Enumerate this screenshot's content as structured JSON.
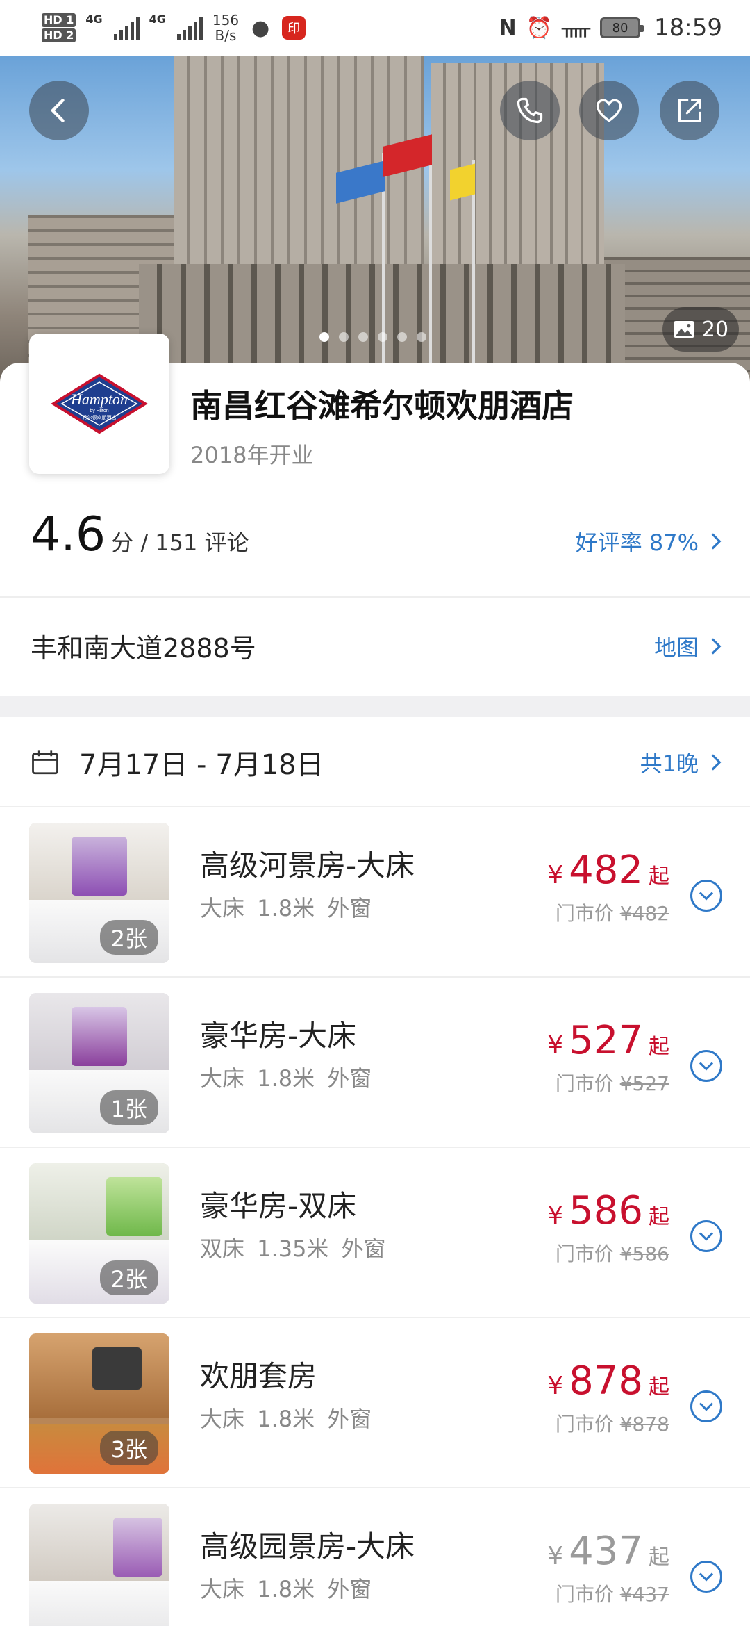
{
  "status_bar": {
    "hd1": "HD 1",
    "hd2": "HD 2",
    "sim1": "4G",
    "sim2": "4G",
    "net_speed_value": "156",
    "net_speed_unit": "B/s",
    "battery": "80",
    "time": "18:59"
  },
  "hero": {
    "photo_count": "20",
    "dots_total": 6,
    "dots_active": 1
  },
  "hotel": {
    "name": "南昌红谷滩希尔顿欢朋酒店",
    "opened": "2018年开业",
    "logo_text": "Hampton",
    "logo_sub": "by Hilton",
    "logo_cn": "希尔顿欢朋酒店",
    "score": "4.6",
    "score_suffix": "分 / 151 评论",
    "positive_rate": "好评率 87%",
    "address": "丰和南大道2888号",
    "map_link": "地图"
  },
  "stay": {
    "dates": "7月17日 - 7月18日",
    "nights": "共1晚"
  },
  "rooms": [
    {
      "name": "高级河景房-大床",
      "desc": "大床 1.8米  外窗",
      "price": "482",
      "rack_label": "门市价",
      "rack_price": "¥482",
      "img_count": "2张",
      "yen": "¥",
      "qi": "起",
      "available": true
    },
    {
      "name": "豪华房-大床",
      "desc": "大床 1.8米  外窗",
      "price": "527",
      "rack_label": "门市价",
      "rack_price": "¥527",
      "img_count": "1张",
      "yen": "¥",
      "qi": "起",
      "available": true
    },
    {
      "name": "豪华房-双床",
      "desc": "双床 1.35米  外窗",
      "price": "586",
      "rack_label": "门市价",
      "rack_price": "¥586",
      "img_count": "2张",
      "yen": "¥",
      "qi": "起",
      "available": true
    },
    {
      "name": "欢朋套房",
      "desc": "大床 1.8米  外窗",
      "price": "878",
      "rack_label": "门市价",
      "rack_price": "¥878",
      "img_count": "3张",
      "yen": "¥",
      "qi": "起",
      "available": true
    },
    {
      "name": "高级园景房-大床",
      "desc": "大床 1.8米  外窗",
      "price": "437",
      "rack_label": "门市价",
      "rack_price": "¥437",
      "img_count": "",
      "yen": "¥",
      "qi": "起",
      "available": false
    }
  ],
  "colors": {
    "accent_blue": "#2f79c8",
    "price_red": "#c8102e",
    "sold_gray": "#9a9a9a"
  },
  "icons": [
    "back-icon",
    "phone-icon",
    "heart-icon",
    "share-icon",
    "image-icon",
    "calendar-icon",
    "chevron-right-icon",
    "chevron-down-icon"
  ]
}
